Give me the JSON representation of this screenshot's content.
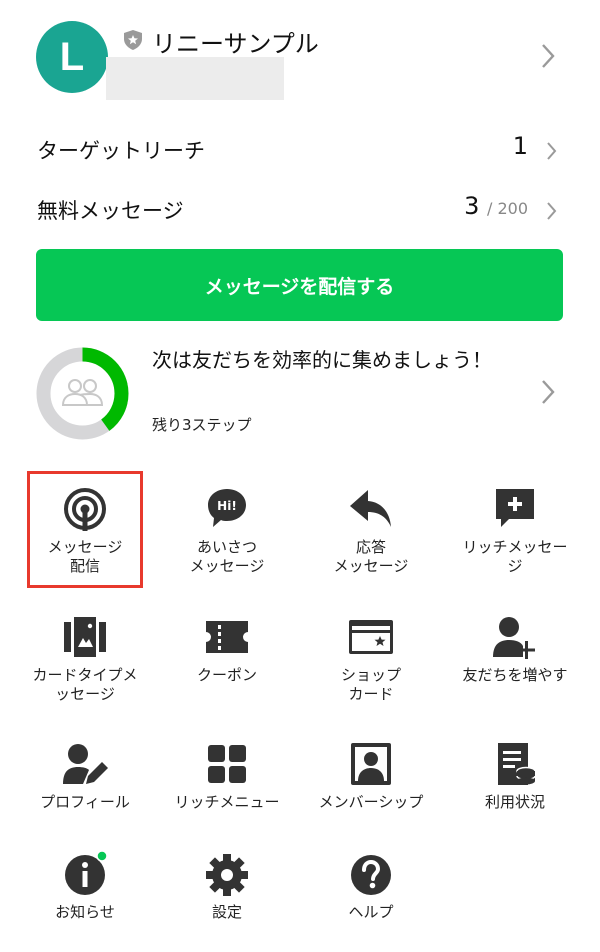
{
  "account": {
    "avatar_letter": "L",
    "name": "リニーサンプル",
    "avatar_color": "#1aa592"
  },
  "stats": [
    {
      "label": "ターゲットリーチ",
      "value": "1",
      "sub": ""
    },
    {
      "label": "無料メッセージ",
      "value": "3",
      "sub": "/ 200"
    }
  ],
  "cta": {
    "label": "メッセージを配信する",
    "color": "#06c755"
  },
  "progress": {
    "title": "次は友だちを効率的に集めましょう！",
    "subtitle": "残り3ステップ",
    "fraction": 0.4,
    "color": "#00b900"
  },
  "menu": [
    {
      "label": "メッセージ\n配信",
      "icon": "broadcast-icon"
    },
    {
      "label": "あいさつ\nメッセージ",
      "icon": "greeting-bubble-icon",
      "icon_text": "Hi!"
    },
    {
      "label": "応答\nメッセージ",
      "icon": "reply-arrow-icon"
    },
    {
      "label": "リッチメッセー\nジ",
      "icon": "rich-message-icon"
    },
    {
      "label": "カードタイプメ\nッセージ",
      "icon": "card-type-icon"
    },
    {
      "label": "クーポン",
      "icon": "coupon-icon"
    },
    {
      "label": "ショップ\nカード",
      "icon": "shop-card-icon"
    },
    {
      "label": "友だちを増やす",
      "icon": "add-friend-icon"
    },
    {
      "label": "プロフィール",
      "icon": "profile-edit-icon"
    },
    {
      "label": "リッチメニュー",
      "icon": "rich-menu-icon"
    },
    {
      "label": "メンバーシップ",
      "icon": "membership-icon"
    },
    {
      "label": "利用状況",
      "icon": "usage-icon"
    },
    {
      "label": "お知らせ",
      "icon": "notice-icon"
    },
    {
      "label": "設定",
      "icon": "settings-gear-icon"
    },
    {
      "label": "ヘルプ",
      "icon": "help-icon"
    }
  ],
  "highlight_color": "#e8392d"
}
